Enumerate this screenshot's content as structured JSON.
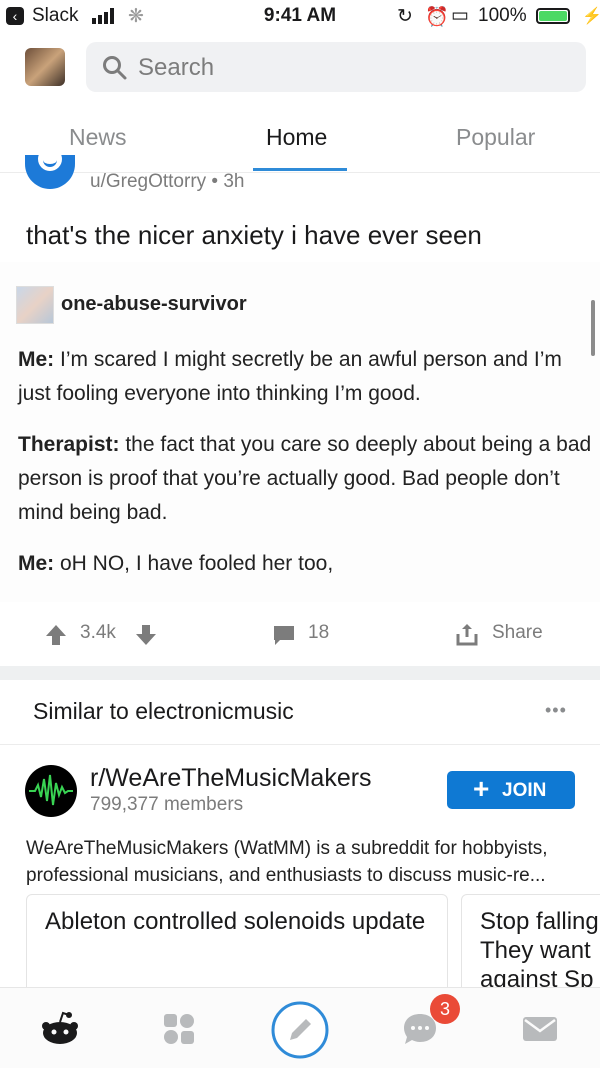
{
  "status_bar": {
    "back_app": "Slack",
    "time": "9:41 AM",
    "battery_percent": "100%"
  },
  "search": {
    "placeholder": "Search"
  },
  "tabs": [
    {
      "label": "News"
    },
    {
      "label": "Home"
    },
    {
      "label": "Popular"
    }
  ],
  "post": {
    "author_meta": "u/GregOttorry • 3h",
    "title": "that's the nicer anxiety i have ever seen",
    "image": {
      "username": "one-abuse-survivor",
      "line1_speaker": "Me:",
      "line1_text": " I’m scared I might secretly be an awful person and I’m just fooling everyone into thinking I’m good.",
      "line2_speaker": "Therapist:",
      "line2_text": " the fact that you care so deeply about being a bad person is proof that you’re actually good. Bad people don’t mind being bad.",
      "line3_speaker": "Me:",
      "line3_text": " oH NO, I have fooled her too,"
    },
    "upvotes": "3.4k",
    "comments": "18",
    "share_label": "Share"
  },
  "similar": {
    "title": "Similar to electronicmusic",
    "more": "•••",
    "community": {
      "name": "r/WeAreTheMusicMakers",
      "members": "799,377 members",
      "join_label": "JOIN",
      "description": "WeAreTheMusicMakers (WatMM) is a subreddit for hobbyists, professional musicians, and enthusiasts to discuss music-re..."
    },
    "cards": [
      {
        "title": "Ableton controlled solenoids update"
      },
      {
        "title": "Stop falling They want against Sp"
      }
    ]
  },
  "bottom_nav": {
    "chat_badge": "3"
  },
  "colors": {
    "accent": "#0f79d3",
    "badge": "#ea4a37",
    "tab_underline": "#2f8bd8"
  }
}
